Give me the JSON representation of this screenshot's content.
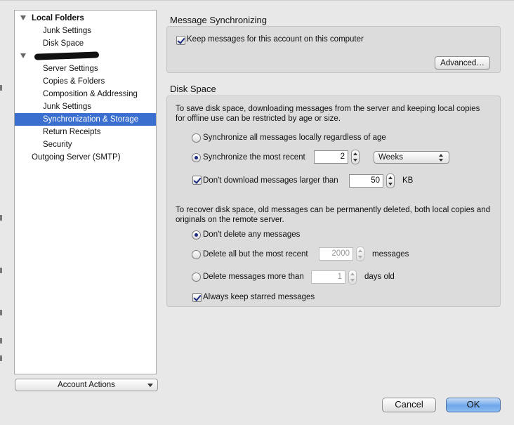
{
  "sidebar": {
    "items": [
      {
        "label": "Local Folders",
        "bold": true,
        "expanded": true
      },
      {
        "label": "Junk Settings"
      },
      {
        "label": "Disk Space"
      },
      {
        "label": "",
        "redacted": true,
        "expanded": true
      },
      {
        "label": "Server Settings"
      },
      {
        "label": "Copies & Folders"
      },
      {
        "label": "Composition & Addressing"
      },
      {
        "label": "Junk Settings"
      },
      {
        "label": "Synchronization & Storage",
        "selected": true
      },
      {
        "label": "Return Receipts"
      },
      {
        "label": "Security"
      },
      {
        "label": "Outgoing Server (SMTP)"
      }
    ],
    "account_actions_label": "Account Actions"
  },
  "sync": {
    "heading": "Message Synchronizing",
    "keep_messages_label": "Keep messages for this account on this computer",
    "keep_messages_checked": true,
    "advanced_label": "Advanced…"
  },
  "disk": {
    "heading": "Disk Space",
    "intro": "To save disk space, downloading messages from the server and keeping local copies for offline use can be restricted by age or size.",
    "sync_all_label": "Synchronize all messages locally regardless of age",
    "sync_recent_label": "Synchronize the most recent",
    "sync_recent_value": "2",
    "sync_recent_unit": "Weeks",
    "dont_download_label": "Don't download messages larger than",
    "dont_download_value": "50",
    "dont_download_unit": "KB",
    "recover_text": "To recover disk space, old messages can be permanently deleted, both local copies and originals on the remote server.",
    "dont_delete_label": "Don't delete any messages",
    "delete_all_but_label": "Delete all but the most recent",
    "delete_all_but_value": "2000",
    "delete_all_but_unit": "messages",
    "delete_older_label": "Delete messages more than",
    "delete_older_value": "1",
    "delete_older_unit": "days old",
    "keep_starred_label": "Always keep starred messages"
  },
  "footer": {
    "cancel_label": "Cancel",
    "ok_label": "OK"
  },
  "colors": {
    "selection": "#3a6fd0",
    "ok_button": "#6ea7ea"
  }
}
